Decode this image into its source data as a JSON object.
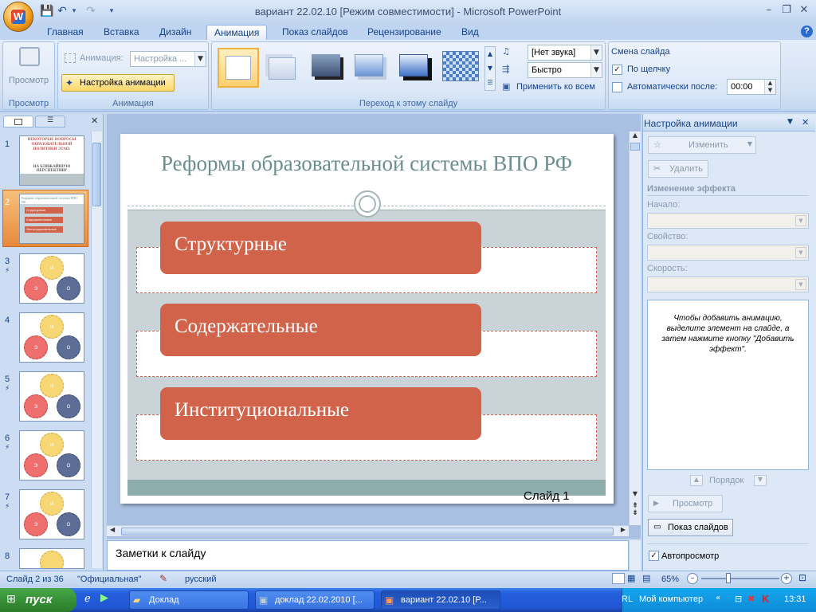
{
  "window": {
    "title": "вариант 22.02.10 [Режим совместимости] - Microsoft PowerPoint"
  },
  "qat": {
    "save_icon": "save-icon",
    "undo_icon": "undo-icon",
    "redo_icon": "redo-icon"
  },
  "tabs": [
    {
      "label": "Главная"
    },
    {
      "label": "Вставка"
    },
    {
      "label": "Дизайн"
    },
    {
      "label": "Анимация"
    },
    {
      "label": "Показ слайдов"
    },
    {
      "label": "Рецензирование"
    },
    {
      "label": "Вид"
    }
  ],
  "ribbon": {
    "preview": {
      "button": "Просмотр",
      "group": "Просмотр"
    },
    "animation": {
      "anim_label": "Анимация:",
      "anim_value": "Настройка ...",
      "custom_button": "Настройка анимации",
      "group": "Анимация"
    },
    "transition": {
      "sound": "[Нет звука]",
      "speed": "Быстро",
      "apply_all": "Применить ко всем",
      "group": "Переход к этому слайду"
    },
    "advance": {
      "title": "Смена слайда",
      "on_click": "По щелчку",
      "on_click_checked": true,
      "auto_after": "Автоматически после:",
      "auto_after_checked": false,
      "time": "00:00"
    }
  },
  "slides_panel": {
    "numbers": [
      "1",
      "2",
      "3",
      "4",
      "5",
      "6",
      "7",
      "8"
    ],
    "selected": "2",
    "thumb1": {
      "title": "НЕКОТОРЫЕ ВОПРОСЫ ОБРАЗОВАТЕЛЬНОЙ ПОЛИТИКИ ЭТАП:",
      "sub": "НА БЛИЖАЙШУЮ ПЕРСПЕКТИВУ"
    },
    "thumb2": {
      "title": "Реформы образовательной системы ВПО РФ",
      "items": [
        "Структурные",
        "Содержательные",
        "Институциональные"
      ]
    },
    "circles": [
      "И",
      "Э",
      "О"
    ]
  },
  "slide": {
    "title": "Реформы образовательной системы ВПО РФ",
    "items": [
      "Структурные",
      "Содержательные",
      "Институциональные"
    ],
    "footer": "Слайд  1"
  },
  "notes": {
    "placeholder": "Заметки к слайду"
  },
  "taskpane": {
    "title": "Настройка анимации",
    "change": "Изменить",
    "delete": "Удалить",
    "effect_header": "Изменение эффекта",
    "start": "Начало:",
    "property": "Свойство:",
    "speed": "Скорость:",
    "hint": "Чтобы добавить анимацию, выделите элемент на слайде, а затем нажмите кнопку \"Добавить эффект\".",
    "order": "Порядок",
    "preview": "Просмотр",
    "slideshow": "Показ слайдов",
    "autopreview": "Автопросмотр",
    "autopreview_checked": true
  },
  "status": {
    "slide": "Слайд 2 из 36",
    "theme": "\"Официальная\"",
    "lang": "русский",
    "zoom": "65%",
    "zoom_level": 0.35
  },
  "taskbar": {
    "start": "пуск",
    "tasks": [
      "Доклад",
      "доклад 22.02.2010 [...",
      "вариант 22.02.10 [Р..."
    ],
    "tray_lang": "RL",
    "tray_label": "Мой компьютер",
    "clock": "13:31"
  },
  "colors": {
    "accent": "#d0634a",
    "slide_bg": "#c9d3d8",
    "title": "#6b8e8e",
    "footer_band": "#8eaeae"
  }
}
